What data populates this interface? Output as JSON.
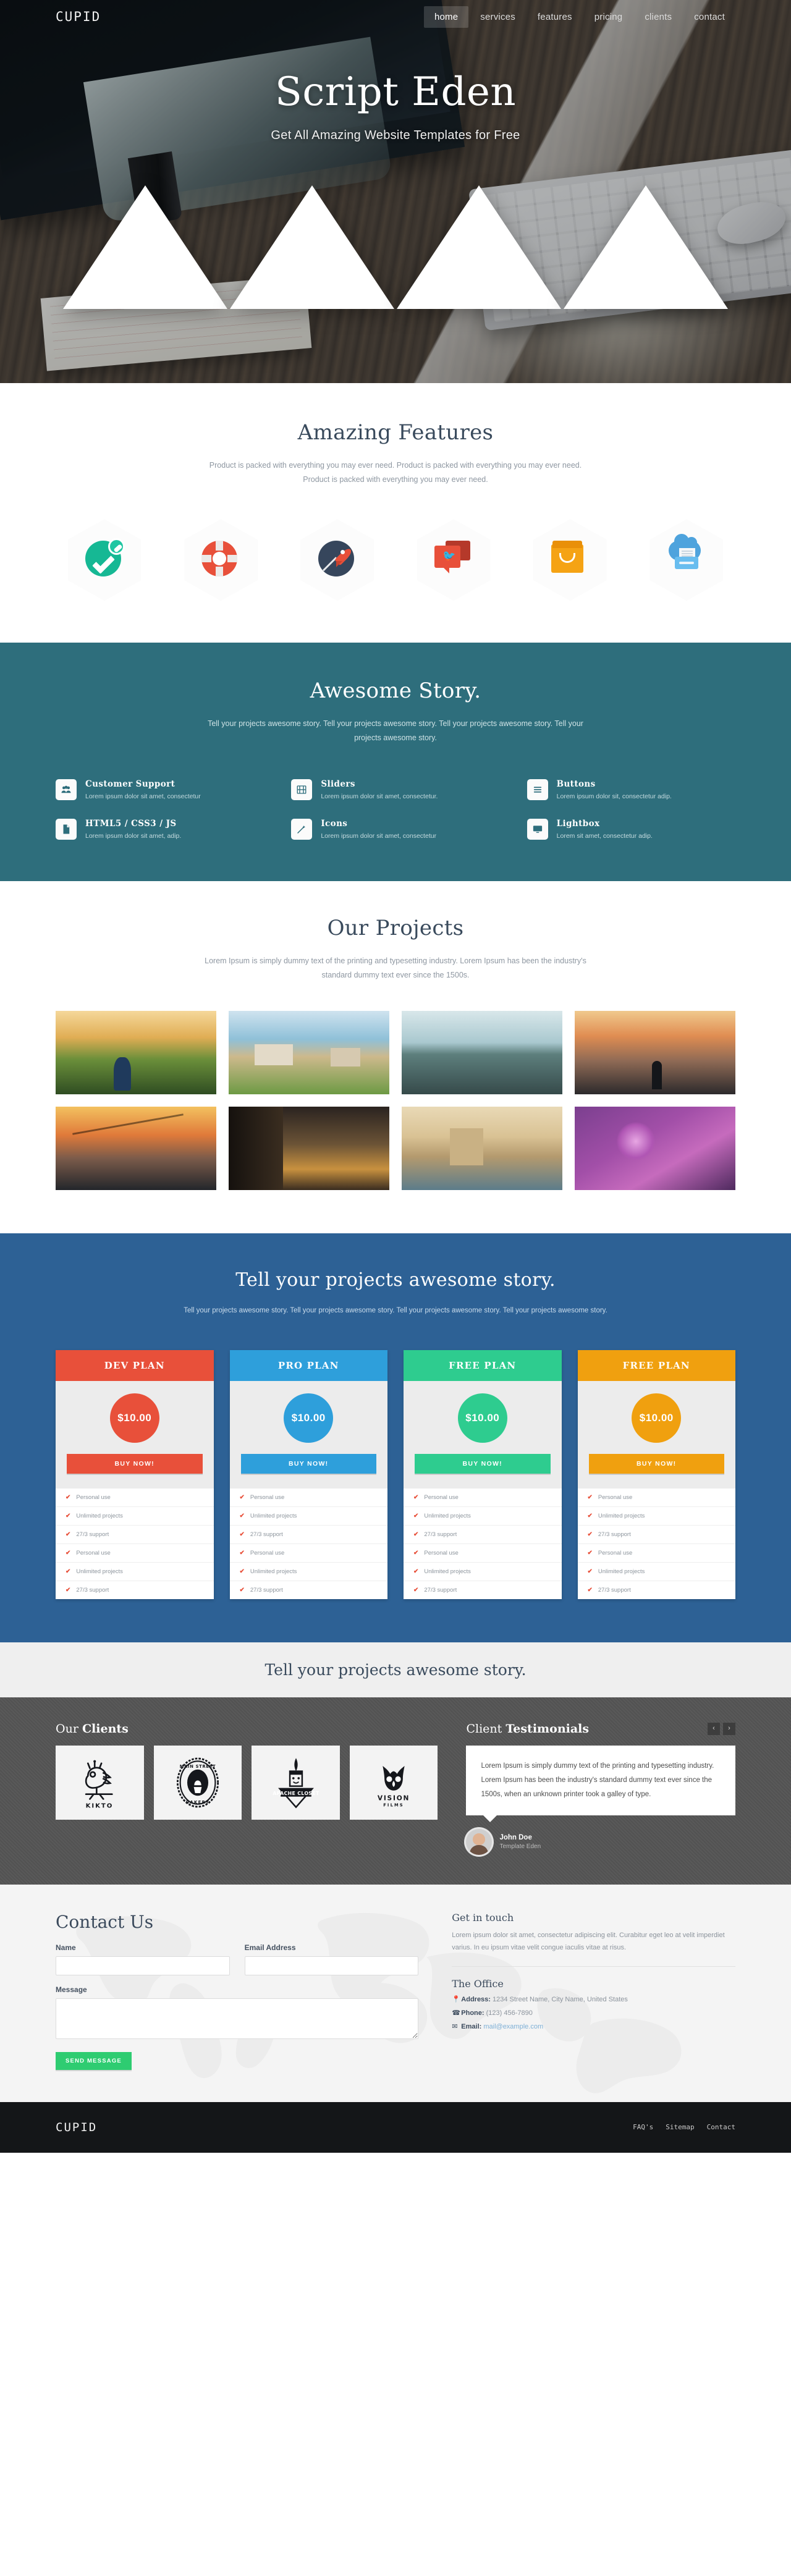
{
  "nav": {
    "brand": "CUPID",
    "items": [
      {
        "label": "home",
        "active": true
      },
      {
        "label": "services",
        "active": false
      },
      {
        "label": "features",
        "active": false
      },
      {
        "label": "pricing",
        "active": false
      },
      {
        "label": "clients",
        "active": false
      },
      {
        "label": "contact",
        "active": false
      }
    ]
  },
  "hero": {
    "title": "Script Eden",
    "subtitle": "Get All Amazing Website Templates for Free",
    "slides": 4
  },
  "features": {
    "title": "Amazing Features",
    "subtitle": "Product is packed with everything you may ever need. Product is packed with everything you may ever need. Product is packed with everything you may ever need.",
    "icons": [
      {
        "name": "check-badge-icon",
        "color": "#16b894"
      },
      {
        "name": "lifebuoy-icon",
        "color": "#e8503a"
      },
      {
        "name": "rocket-icon",
        "color": "#36465c"
      },
      {
        "name": "chat-bubble-twitter-icon",
        "color": "#e8503a"
      },
      {
        "name": "shopping-bag-icon",
        "color": "#f5a314"
      },
      {
        "name": "cloud-print-icon",
        "color": "#4ea3dd"
      }
    ]
  },
  "story": {
    "title": "Awesome Story.",
    "subtitle": "Tell your projects awesome story. Tell your projects awesome story. Tell your projects awesome story. Tell your projects awesome story.",
    "items": [
      {
        "icon": "users-icon",
        "title": "Customer Support",
        "desc": "Lorem ipsum dolor sit amet, consectetur"
      },
      {
        "icon": "film-icon",
        "title": "Sliders",
        "desc": "Lorem ipsum dolor sit amet, consectetur."
      },
      {
        "icon": "list-icon",
        "title": "Buttons",
        "desc": "Lorem ipsum dolor sit, consectetur adip."
      },
      {
        "icon": "file-icon",
        "title": "HTML5 / CSS3 / JS",
        "desc": "Lorem ipsum dolor sit amet, adip."
      },
      {
        "icon": "magic-wand-icon",
        "title": "Icons",
        "desc": "Lorem ipsum dolor sit amet, consectetur"
      },
      {
        "icon": "monitor-icon",
        "title": "Lightbox",
        "desc": "Lorem sit amet, consectetur adip."
      }
    ]
  },
  "projects": {
    "title": "Our Projects",
    "subtitle": "Lorem Ipsum is simply dummy text of the printing and typesetting industry. Lorem Ipsum has been the industry's standard dummy text ever since the 1500s.",
    "tiles": [
      {
        "name": "project-girl-in-field"
      },
      {
        "name": "project-seaside-village"
      },
      {
        "name": "project-lake-shore"
      },
      {
        "name": "project-person-sunset"
      },
      {
        "name": "project-airplane-runway"
      },
      {
        "name": "project-ancient-columns"
      },
      {
        "name": "project-desert-rocks"
      },
      {
        "name": "project-purple-flowers"
      }
    ]
  },
  "pricing": {
    "title": "Tell your projects awesome story.",
    "subtitle": "Tell your projects awesome story. Tell your projects awesome story. Tell your projects awesome story. Tell your projects awesome story.",
    "buy_label": "BUY NOW!",
    "plans": [
      {
        "name": "DEV PLAN",
        "price": "$10.00",
        "color": "#e8503a",
        "features": [
          "Personal use",
          "Unlimited projects",
          "27/3 support",
          "Personal use",
          "Unlimited projects",
          "27/3 support"
        ]
      },
      {
        "name": "PRO PLAN",
        "price": "$10.00",
        "color": "#2e9fdb",
        "features": [
          "Personal use",
          "Unlimited projects",
          "27/3 support",
          "Personal use",
          "Unlimited projects",
          "27/3 support"
        ]
      },
      {
        "name": "FREE PLAN",
        "price": "$10.00",
        "color": "#2ecc8f",
        "features": [
          "Personal use",
          "Unlimited projects",
          "27/3 support",
          "Personal use",
          "Unlimited projects",
          "27/3 support"
        ]
      },
      {
        "name": "FREE PLAN",
        "price": "$10.00",
        "color": "#f0a00f",
        "features": [
          "Personal use",
          "Unlimited projects",
          "27/3 support",
          "Personal use",
          "Unlimited projects",
          "27/3 support"
        ]
      }
    ]
  },
  "midband": {
    "title": "Tell your projects awesome story."
  },
  "clients": {
    "heading_light": "Our ",
    "heading_bold": "Clients",
    "prev": "‹",
    "next": "›",
    "logos": [
      {
        "name": "kikto-logo",
        "label": "KIKTO"
      },
      {
        "name": "main-street-bakery-logo",
        "label": "MAIN STREET BAKERY"
      },
      {
        "name": "apache-closet-logo",
        "label": "APACHE CLOSET"
      },
      {
        "name": "vision-films-logo",
        "label": "VISION FILMS"
      }
    ]
  },
  "testimonials": {
    "heading_light": "Client ",
    "heading_bold": "Testimonials",
    "prev": "‹",
    "next": "›",
    "quote": "Lorem Ipsum is simply dummy text of the printing and typesetting industry. Lorem Ipsum has been the industry's standard dummy text ever since the 1500s, when an unknown printer took a galley of type.",
    "author_name": "John Doe",
    "author_role": "Template Eden"
  },
  "contact": {
    "title": "Contact Us",
    "name_label": "Name",
    "name_value": "",
    "name_placeholder": "",
    "email_label": "Email Address",
    "email_value": "",
    "email_placeholder": "",
    "message_label": "Message",
    "message_value": "",
    "message_placeholder": "",
    "send_label": "SEND MESSAGE",
    "git_title": "Get in touch",
    "git_text": "Lorem ipsum dolor sit amet, consectetur adipiscing elit. Curabitur eget leo at velit imperdiet varius. In eu ipsum vitae velit congue iaculis vitae at risus.",
    "office_title": "The Office",
    "address_label": "Address:",
    "address_value": "1234 Street Name, City Name, United States",
    "phone_label": "Phone:",
    "phone_value": "(123) 456-7890",
    "email_lbl": "Email:",
    "email_link": "mail@example.com"
  },
  "footer": {
    "brand": "CUPID",
    "links": [
      "FAQ's",
      "Sitemap",
      "Contact"
    ]
  }
}
